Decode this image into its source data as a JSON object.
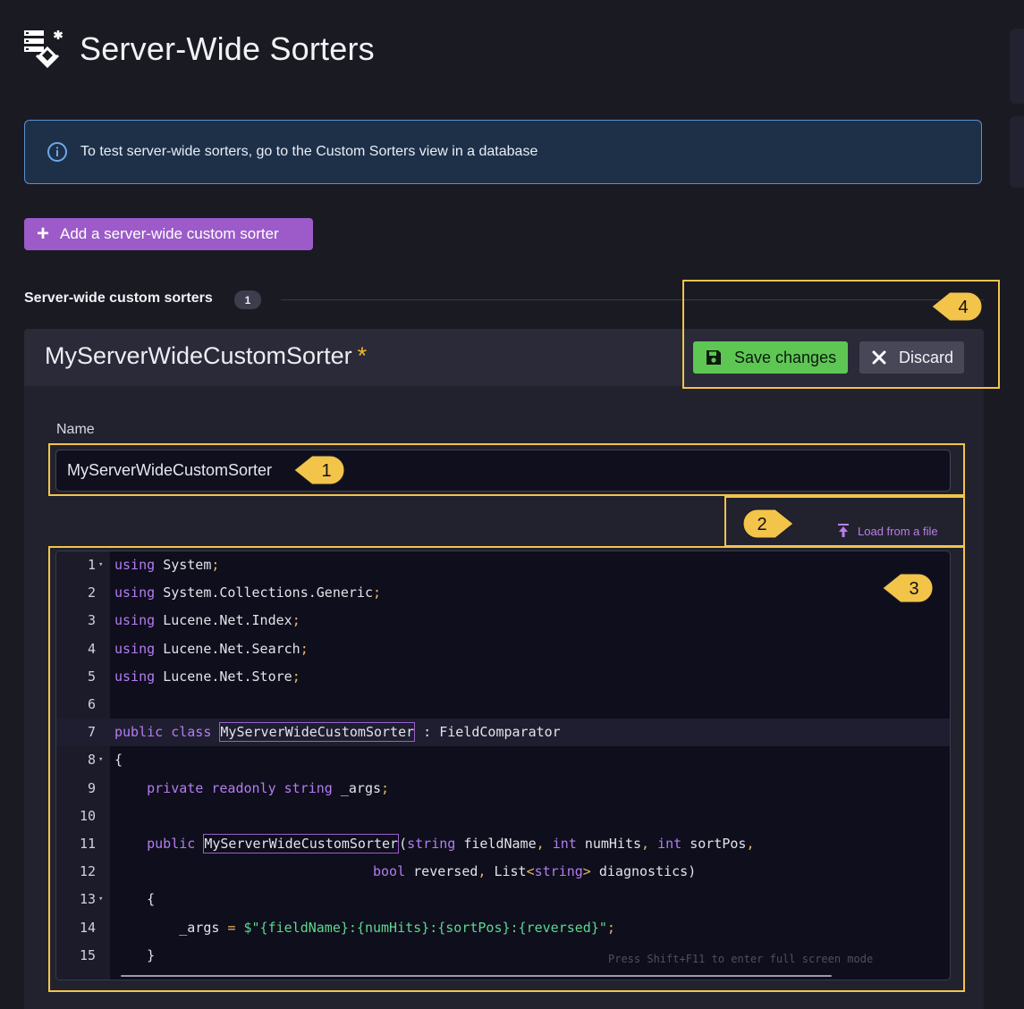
{
  "page": {
    "title": "Server-Wide Sorters",
    "logo_icon": "server-sorter-icon"
  },
  "info_banner": {
    "icon": "info-icon",
    "text": "To test server-wide sorters, go to the Custom Sorters view in a database"
  },
  "add_button": {
    "icon": "plus-icon",
    "label": "Add a server-wide custom sorter"
  },
  "sorters_section": {
    "title": "Server-wide custom sorters",
    "count": "1"
  },
  "sorter_card": {
    "title": "MyServerWideCustomSorter",
    "modified_marker": "*",
    "save_label": "Save changes",
    "discard_label": "Discard",
    "name_label": "Name",
    "name_value": "MyServerWideCustomSorter",
    "load_label": "Load from a file",
    "editor_hint": "Press Shift+F11 to enter full screen mode",
    "code_lines": [
      {
        "n": "1",
        "fold": true
      },
      {
        "n": "2",
        "fold": false
      },
      {
        "n": "3",
        "fold": false
      },
      {
        "n": "4",
        "fold": false
      },
      {
        "n": "5",
        "fold": false
      },
      {
        "n": "6",
        "fold": false
      },
      {
        "n": "7",
        "fold": false
      },
      {
        "n": "8",
        "fold": true
      },
      {
        "n": "9",
        "fold": false
      },
      {
        "n": "10",
        "fold": false
      },
      {
        "n": "11",
        "fold": false
      },
      {
        "n": "12",
        "fold": false
      },
      {
        "n": "13",
        "fold": true
      },
      {
        "n": "14",
        "fold": false
      },
      {
        "n": "15",
        "fold": false
      }
    ],
    "code_tokens": {
      "kw_using": "using",
      "ns_system": "System",
      "ns_generic": "System.Collections.Generic",
      "ns_index": "Lucene.Net.Index",
      "ns_search": "Lucene.Net.Search",
      "ns_store": "Lucene.Net.Store",
      "kw_public": "public",
      "kw_class": "class",
      "class_name": "MyServerWideCustomSorter",
      "base_class": "FieldComparator",
      "kw_private": "private",
      "kw_readonly": "readonly",
      "kw_string": "string",
      "kw_int": "int",
      "kw_bool": "bool",
      "field_args": "_args",
      "param_fieldName": "fieldName",
      "param_numHits": "numHits",
      "param_sortPos": "sortPos",
      "param_reversed": "reversed",
      "type_list": "List",
      "param_diagnostics": "diagnostics",
      "interp_string": "$\"{fieldName}:{numHits}:{sortPos}:{reversed}\""
    }
  },
  "callouts": [
    "1",
    "2",
    "3",
    "4"
  ],
  "colors": {
    "accent_purple": "#9c5bc9",
    "save_green": "#5ec754",
    "callout_yellow": "#f3c44a",
    "info_blue": "#5a8fd0"
  }
}
